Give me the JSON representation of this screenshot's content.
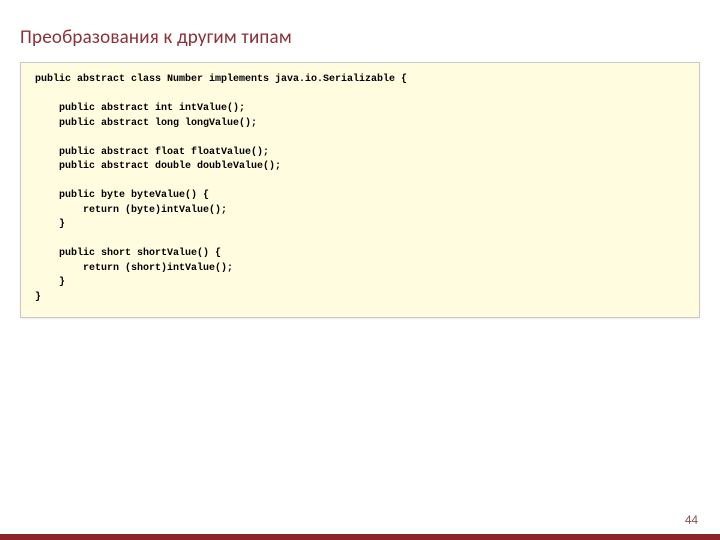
{
  "title": "Преобразования к другим типам",
  "code": "public abstract class Number implements java.io.Serializable {\n\n    public abstract int intValue();\n    public abstract long longValue();\n\n    public abstract float floatValue();\n    public abstract double doubleValue();\n\n    public byte byteValue() {\n        return (byte)intValue();\n    }\n\n    public short shortValue() {\n        return (short)intValue();\n    }\n}",
  "page_number": "44"
}
